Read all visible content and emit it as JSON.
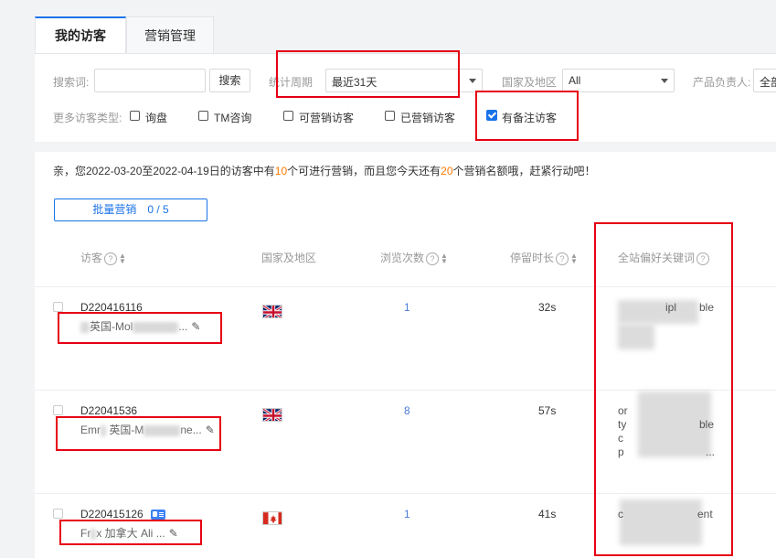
{
  "tabs": [
    {
      "label": "我的访客",
      "active": true
    },
    {
      "label": "营销管理",
      "active": false
    }
  ],
  "filters": {
    "search_label": "搜索词:",
    "search_value": "",
    "search_button": "搜索",
    "period_label": "统计周期",
    "period_value": "最近31天",
    "region_label": "国家及地区",
    "region_value": "All",
    "owner_label": "产品负责人:",
    "owner_value": "全部",
    "types_label": "更多访客类型:",
    "types": [
      {
        "label": "询盘",
        "checked": false
      },
      {
        "label": "TM咨询",
        "checked": false
      },
      {
        "label": "可营销访客",
        "checked": false
      },
      {
        "label": "已营销访客",
        "checked": false
      },
      {
        "label": "有备注访客",
        "checked": true
      }
    ]
  },
  "notice": {
    "prefix": "亲，您2022-03-20至2022-04-19日的访客中有",
    "count1": "10",
    "middle": "个可进行营销，而且您今天还有",
    "count2": "20",
    "suffix": "个营销名额哦，赶紧行动吧！"
  },
  "batch_button": "批量营销　0 / 5",
  "columns": {
    "visitor": "访客",
    "region": "国家及地区",
    "views": "浏览次数",
    "stay": "停留时长",
    "keywords": "全站偏好关键词"
  },
  "rows": [
    {
      "id": "D220416116",
      "name_visible": "英国-Mol",
      "name_tail": "...",
      "flag": "uk",
      "views": "1",
      "stay": "32s",
      "keywords": [
        "ipl",
        "ble"
      ]
    },
    {
      "id": "D22041536",
      "name_visible": "Emr",
      "name_mid": "英国-M",
      "name_tail": "ne...",
      "flag": "uk",
      "views": "8",
      "stay": "57s",
      "keywords": [
        "or",
        "ty",
        "ble",
        "c",
        "p",
        "..."
      ]
    },
    {
      "id": "D220415126",
      "name_visible": "Fr",
      "name_mid": "x 加拿大 Ali",
      "name_tail": "...",
      "flag": "ca",
      "views": "1",
      "stay": "41s",
      "keywords": [
        "c",
        "ent"
      ]
    }
  ],
  "colors": {
    "accent": "#1a73e8",
    "highlight": "#ff7a00",
    "annotation": "#e60012"
  }
}
